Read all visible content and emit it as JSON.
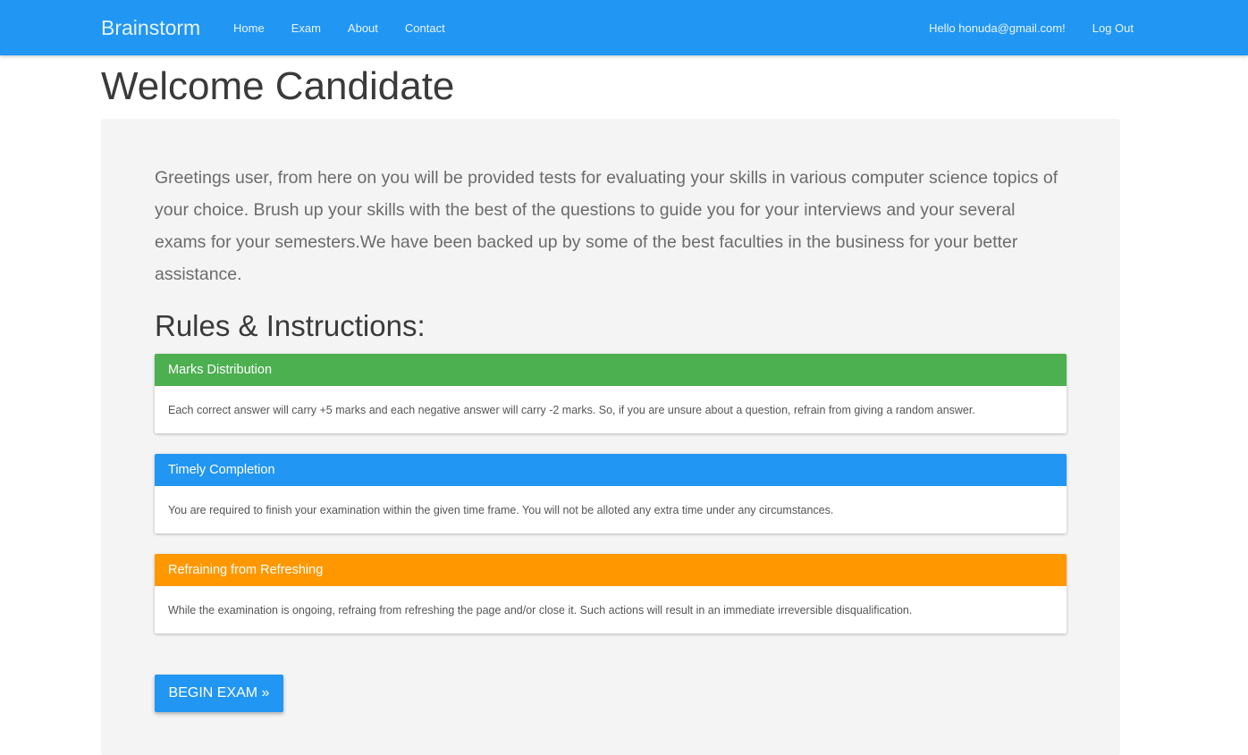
{
  "navbar": {
    "brand": "Brainstorm",
    "links": [
      "Home",
      "Exam",
      "About",
      "Contact"
    ],
    "greeting": "Hello honuda@gmail.com!",
    "logout": "Log Out",
    "color": "#2196f3"
  },
  "main": {
    "title": "Welcome Candidate",
    "intro": "Greetings user, from here on you will be provided tests for evaluating your skills in various computer science topics of your choice. Brush up your skills with the best of the questions to guide you for your interviews and your several exams for your semesters.We have been backed up by some of the best faculties in the business for your better assistance.",
    "rules_heading": "Rules & Instructions:",
    "panels": [
      {
        "title": "Marks Distribution",
        "body": "Each correct answer will carry +5 marks and each negative answer will carry -2 marks. So, if you are unsure about a question, refrain from giving a random answer.",
        "color": "#4caf50"
      },
      {
        "title": "Timely Completion",
        "body": "You are required to finish your examination within the given time frame. You will not be alloted any extra time under any circumstances.",
        "color": "#2196f3"
      },
      {
        "title": "Refraining from Refreshing",
        "body": "While the examination is ongoing, refraing from refreshing the page and/or close it. Such actions will result in an immediate irreversible disqualification.",
        "color": "#ff9800"
      }
    ],
    "begin_button": "BEGIN EXAM »"
  }
}
